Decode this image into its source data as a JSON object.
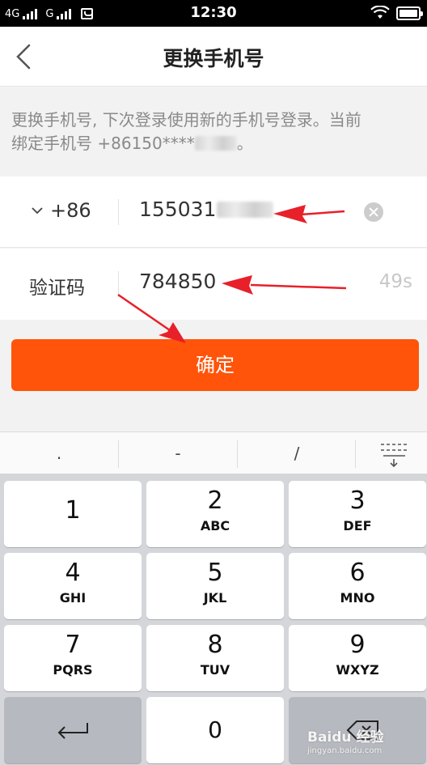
{
  "status_bar": {
    "network_1": "4G",
    "network_2": "G",
    "time": "12:30"
  },
  "header": {
    "title": "更换手机号"
  },
  "info": {
    "line1": "更换手机号, 下次登录使用新的手机号登录。当前",
    "line2_prefix": "绑定手机号 +86150****",
    "line2_suffix": "。"
  },
  "phone_row": {
    "country_code": "+86",
    "phone_value": "155031"
  },
  "code_row": {
    "label": "验证码",
    "code_value": "784850",
    "countdown": "49s"
  },
  "confirm_button": {
    "label": "确定"
  },
  "keyboard": {
    "symbols": [
      ".",
      "-",
      "/"
    ],
    "keys": [
      {
        "num": "1",
        "letters": ""
      },
      {
        "num": "2",
        "letters": "ABC"
      },
      {
        "num": "3",
        "letters": "DEF"
      },
      {
        "num": "4",
        "letters": "GHI"
      },
      {
        "num": "5",
        "letters": "JKL"
      },
      {
        "num": "6",
        "letters": "MNO"
      },
      {
        "num": "7",
        "letters": "PQRS"
      },
      {
        "num": "8",
        "letters": "TUV"
      },
      {
        "num": "9",
        "letters": "WXYZ"
      }
    ],
    "zero": "0"
  },
  "watermark": {
    "brand": "Baidu 经验",
    "url": "jingyan.baidu.com"
  },
  "colors": {
    "accent": "#ff5409",
    "annotation": "#e8202a"
  }
}
